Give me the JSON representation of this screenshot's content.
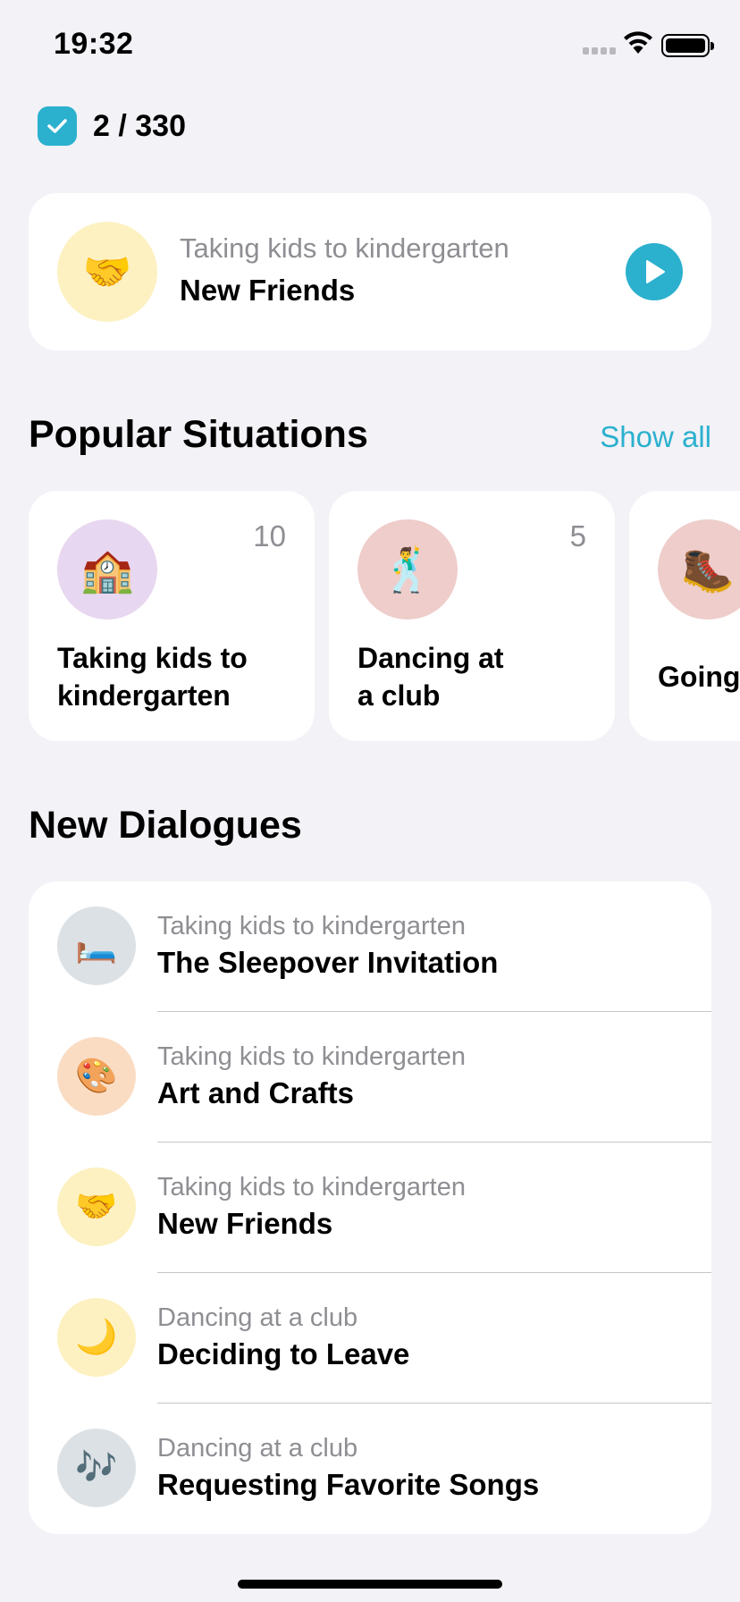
{
  "status_bar": {
    "time": "19:32"
  },
  "progress": {
    "text": "2 / 330"
  },
  "continue_card": {
    "emoji": "🤝",
    "subtitle": "Taking kids to kindergarten",
    "title": "New Friends"
  },
  "popular": {
    "title": "Popular Situations",
    "show_all": "Show all",
    "items": [
      {
        "emoji": "🏫",
        "count": "10",
        "title": "Taking kids to kindergarten",
        "color": "#E8D7F0"
      },
      {
        "emoji": "🕺",
        "count": "5",
        "title": "Dancing at a club",
        "color": "#EECDCB"
      },
      {
        "emoji": "🥾",
        "count": "",
        "title": "Going",
        "color": "#EECDCB"
      }
    ]
  },
  "new_dialogues": {
    "title": "New Dialogues",
    "items": [
      {
        "emoji": "🛏️",
        "subtitle": "Taking kids to kindergarten",
        "title": "The Sleepover Invitation",
        "color": "#DCE1E5"
      },
      {
        "emoji": "🎨",
        "subtitle": "Taking kids to kindergarten",
        "title": "Art and Crafts",
        "color": "#FADCC3"
      },
      {
        "emoji": "🤝",
        "subtitle": "Taking kids to kindergarten",
        "title": "New Friends",
        "color": "#FDF1C2"
      },
      {
        "emoji": "🌙",
        "subtitle": "Dancing at a club",
        "title": "Deciding to Leave",
        "color": "#FDF1C2"
      },
      {
        "emoji": "🎶",
        "subtitle": "Dancing at a club",
        "title": "Requesting Favorite Songs",
        "color": "#DCE1E5"
      }
    ]
  },
  "colors": {
    "accent": "#2BB0CE",
    "background": "#F2F2F7"
  }
}
